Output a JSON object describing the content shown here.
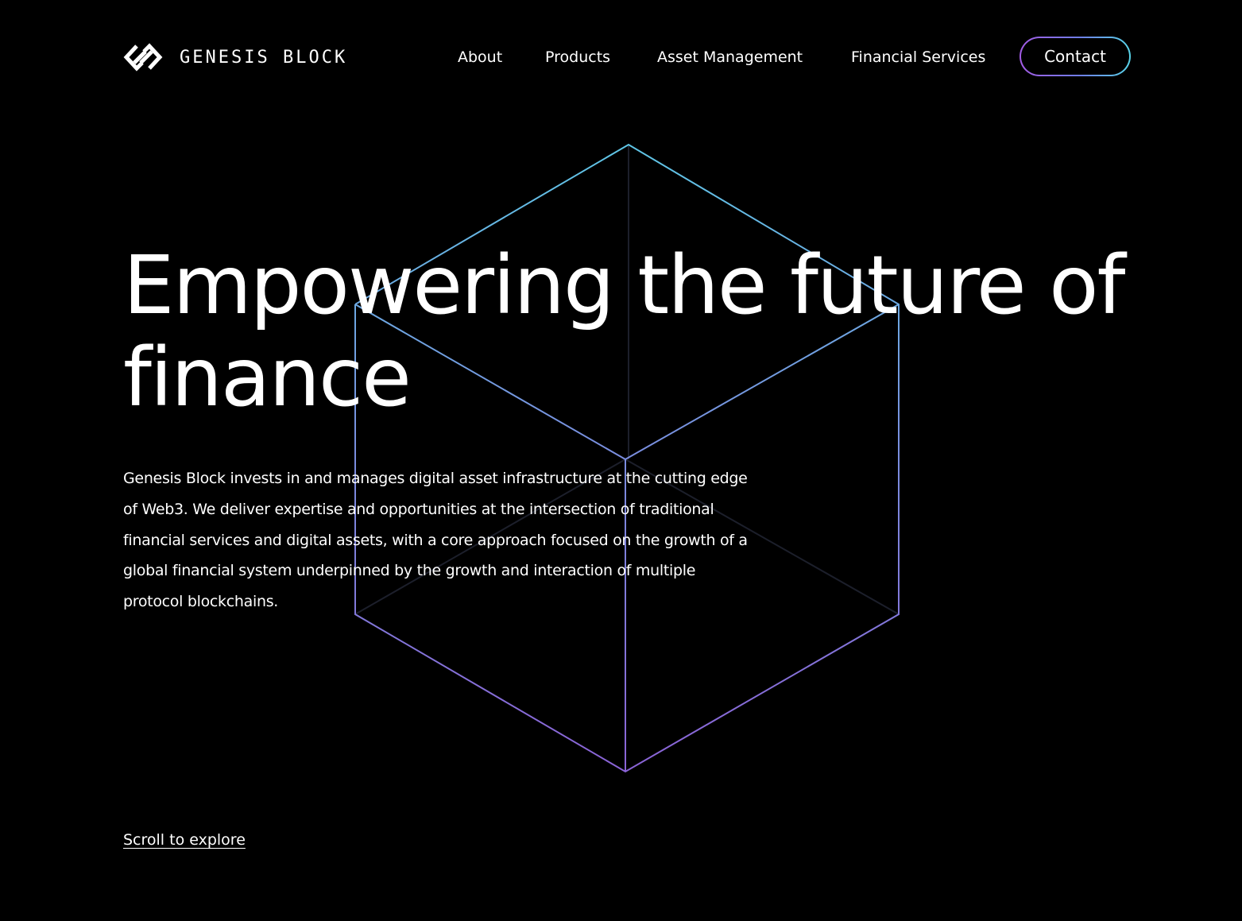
{
  "brand": {
    "name": "GENESIS BLOCK",
    "logo_icon": "genesis-block-logo-icon"
  },
  "nav": {
    "items": [
      {
        "label": "About"
      },
      {
        "label": "Products"
      },
      {
        "label": "Asset Management"
      },
      {
        "label": "Financial Services"
      }
    ],
    "contact_label": "Contact"
  },
  "hero": {
    "title": "Empowering the future of finance",
    "description": "Genesis Block invests in and manages digital asset infrastructure at the cutting edge of Web3. We deliver expertise and opportunities at the intersection of traditional financial services and digital assets, with a core approach focused on the growth of a global financial system underpinned by the growth and interaction of multiple protocol blockchains.",
    "scroll_label": "Scroll to explore"
  },
  "colors": {
    "background": "#000000",
    "text": "#ffffff",
    "accent_cyan": "#58d4e8",
    "accent_purple": "#a35be5"
  }
}
